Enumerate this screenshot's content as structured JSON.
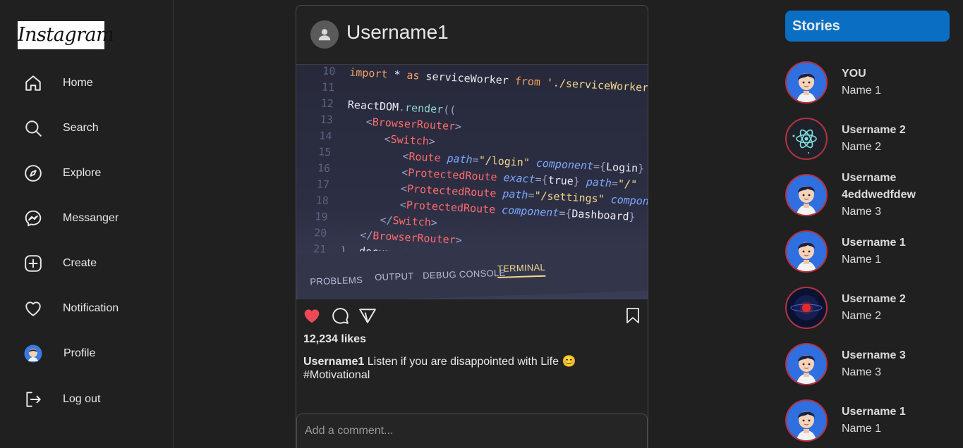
{
  "app": {
    "logo_text": "Instagram"
  },
  "sidebar": {
    "items": [
      {
        "label": "Home",
        "icon": "home-icon"
      },
      {
        "label": "Search",
        "icon": "search-icon"
      },
      {
        "label": "Explore",
        "icon": "compass-icon"
      },
      {
        "label": "Messanger",
        "icon": "messenger-icon"
      },
      {
        "label": "Create",
        "icon": "plus-square-icon"
      },
      {
        "label": "Notification",
        "icon": "heart-icon"
      },
      {
        "label": "Profile",
        "icon": "avatar-icon"
      },
      {
        "label": "Log out",
        "icon": "logout-icon"
      }
    ]
  },
  "post": {
    "username": "Username1",
    "image_code": {
      "lines": [
        {
          "n": "10",
          "html": "<span class='cb'>import</span> <span class='cw'>*</span> <span class='cb'>as</span> <span class='cw'>serviceWorker</span> <span class='cb'>from</span> <span class='cs'>'./serviceWorker'</span>"
        },
        {
          "n": "11",
          "html": ""
        },
        {
          "n": "12",
          "html": "<span class='cw'>ReactDOM</span><span class='cp'>.</span><span class='cf'>render</span><span class='cp'>((</span>"
        },
        {
          "n": "13",
          "html": "&nbsp;&nbsp;&nbsp;<span class='cp'>&lt;</span><span class='ct'>BrowserRouter</span><span class='cp'>&gt;</span>"
        },
        {
          "n": "14",
          "html": "&nbsp;&nbsp;&nbsp;&nbsp;&nbsp;&nbsp;<span class='cp'>&lt;</span><span class='ct'>Switch</span><span class='cp'>&gt;</span>"
        },
        {
          "n": "15",
          "html": "&nbsp;&nbsp;&nbsp;&nbsp;&nbsp;&nbsp;&nbsp;&nbsp;&nbsp;<span class='cp'>&lt;</span><span class='ct'>Route</span> <span class='ca'>path</span><span class='cp'>=</span><span class='cs'>\"/login\"</span> <span class='ca'>component</span><span class='cp'>={</span><span class='cw'>Login</span><span class='cp'>}</span>"
        },
        {
          "n": "16",
          "html": "&nbsp;&nbsp;&nbsp;&nbsp;&nbsp;&nbsp;&nbsp;&nbsp;&nbsp;<span class='cp'>&lt;</span><span class='ct'>ProtectedRoute</span> <span class='ca'>exact</span><span class='cp'>={</span><span class='cw'>true</span><span class='cp'>}</span> <span class='ca'>path</span><span class='cp'>=</span><span class='cs'>\"/\"</span>"
        },
        {
          "n": "17",
          "html": "&nbsp;&nbsp;&nbsp;&nbsp;&nbsp;&nbsp;&nbsp;&nbsp;&nbsp;<span class='cp'>&lt;</span><span class='ct'>ProtectedRoute</span> <span class='ca'>path</span><span class='cp'>=</span><span class='cs'>\"/settings\"</span> <span class='ca'>component</span>"
        },
        {
          "n": "18",
          "html": "&nbsp;&nbsp;&nbsp;&nbsp;&nbsp;&nbsp;&nbsp;&nbsp;&nbsp;<span class='cp'>&lt;</span><span class='ct'>ProtectedRoute</span> <span class='ca'>component</span><span class='cp'>={</span><span class='cw'>Dashboard</span><span class='cp'>}</span>"
        },
        {
          "n": "19",
          "html": "&nbsp;&nbsp;&nbsp;&nbsp;&nbsp;&nbsp;<span class='cp'>&lt;/</span><span class='ct'>Switch</span><span class='cp'>&gt;</span>"
        },
        {
          "n": "20",
          "html": "&nbsp;&nbsp;&nbsp;<span class='cp'>&lt;/</span><span class='ct'>BrowserRouter</span><span class='cp'>&gt;</span>"
        },
        {
          "n": "21",
          "html": "<span class='cp'>),</span> <span class='cw'>document</span><span class='cp'>.</span><span class='cf'>getElementById</span><span class='cp'>(</span><span class='cs'>'root'</span><span class='cp'>));</span>"
        }
      ],
      "tabs": [
        "PROBLEMS",
        "OUTPUT",
        "DEBUG CONSOLE",
        "TERMINAL"
      ]
    },
    "likes": "12,234 likes",
    "caption_user": "Username1",
    "caption_text": "Listen if you are disappointed with Life 😊 #Motivational",
    "comment_placeholder": "Add a comment..."
  },
  "stories": {
    "title": "Stories",
    "items": [
      {
        "username": "YOU",
        "name": "Name 1",
        "avatar": "cartoon-boy"
      },
      {
        "username": "Username 2",
        "name": "Name 2",
        "avatar": "react-logo"
      },
      {
        "username": "Username 4eddwedfdew",
        "name": "Name 3",
        "avatar": "cartoon-boy"
      },
      {
        "username": "Username 1",
        "name": "Name 1",
        "avatar": "cartoon-boy"
      },
      {
        "username": "Username 2",
        "name": "Name 2",
        "avatar": "red-planet"
      },
      {
        "username": "Username 3",
        "name": "Name 3",
        "avatar": "cartoon-boy"
      },
      {
        "username": "Username 1",
        "name": "Name 1",
        "avatar": "cartoon-boy"
      }
    ]
  },
  "colors": {
    "background": "#202020",
    "accent": "#0a6fc2",
    "like_red": "#ed4956",
    "story_ring": "#b9303a"
  }
}
